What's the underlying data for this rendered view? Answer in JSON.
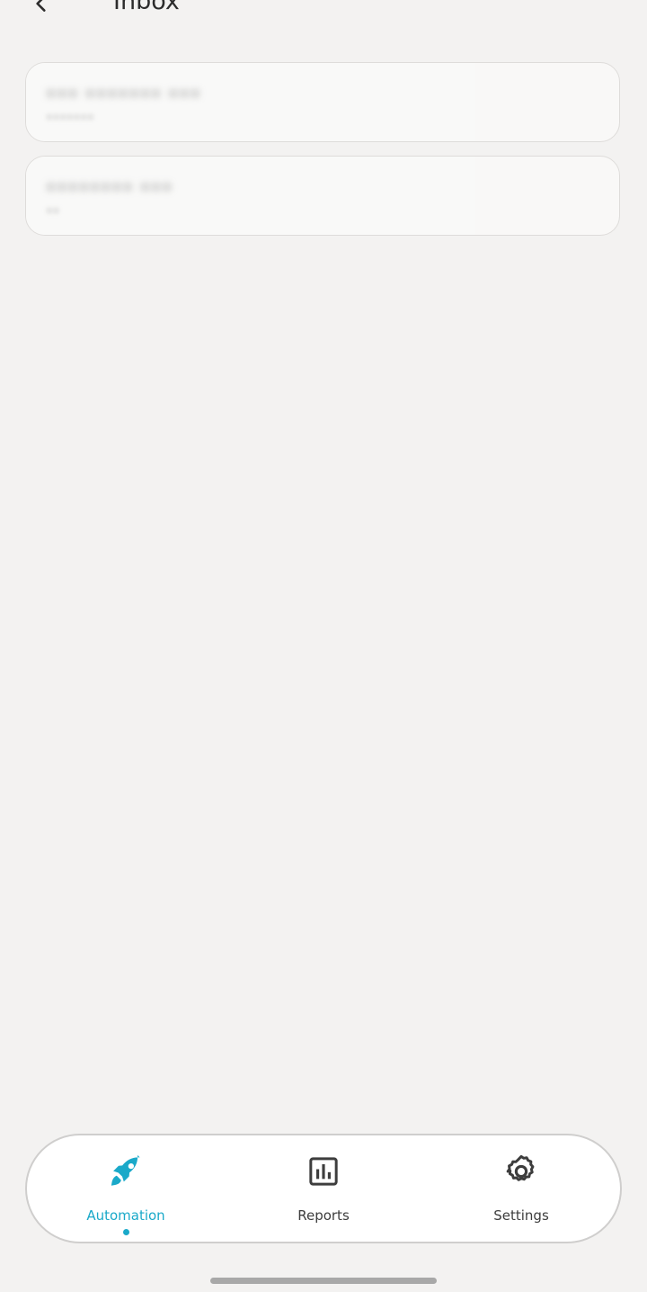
{
  "header": {
    "title": "Inbox",
    "back_icon": "chevron-left-icon"
  },
  "inbox": {
    "items": [
      {
        "title": "••• ••••••• •••",
        "subtitle": "•••••••"
      },
      {
        "title": "•••••••• •••",
        "subtitle": "••"
      }
    ]
  },
  "bottom_nav": {
    "items": [
      {
        "label": "Automation",
        "icon": "rocket-icon",
        "active": true
      },
      {
        "label": "Reports",
        "icon": "bar-chart-icon",
        "active": false
      },
      {
        "label": "Settings",
        "icon": "gear-icon",
        "active": false
      }
    ]
  },
  "colors": {
    "background": "#f3f2f1",
    "accent": "#1aa9c9",
    "card_border": "#dedcda",
    "nav_border": "#cfcecd",
    "text_primary": "#2c2c2c",
    "text_secondary": "#3d3d3d"
  }
}
